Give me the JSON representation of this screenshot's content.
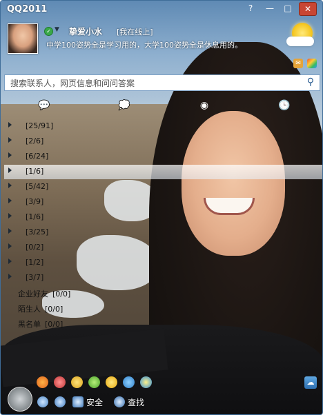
{
  "window": {
    "title": "QQ2011",
    "buttons": {
      "help": "?",
      "minimize": "—",
      "maximize": "□",
      "close": "✕"
    }
  },
  "profile": {
    "nickname": "挚爱小水",
    "status": "[我在线上]",
    "signature": "中学100姿势全是学习用的，大学100姿势全是休息用的。"
  },
  "search": {
    "placeholder": "搜索联系人，网页信息和问问答案",
    "icon": "⚲"
  },
  "tabs": [
    {
      "name": "contacts",
      "glyph": "💬"
    },
    {
      "name": "groups",
      "glyph": "💭"
    },
    {
      "name": "qzone",
      "glyph": "◉"
    },
    {
      "name": "recent",
      "glyph": "🕒"
    }
  ],
  "groups": [
    {
      "label": "",
      "count": "[25/91]"
    },
    {
      "label": "",
      "count": "[2/6]"
    },
    {
      "label": "",
      "count": "[6/24]"
    },
    {
      "label": "",
      "count": "[1/6]"
    },
    {
      "label": "",
      "count": "[5/42]"
    },
    {
      "label": "",
      "count": "[3/9]"
    },
    {
      "label": "",
      "count": "[1/6]"
    },
    {
      "label": "",
      "count": "[3/25]"
    },
    {
      "label": "",
      "count": "[0/2]"
    },
    {
      "label": "",
      "count": "[1/2]"
    },
    {
      "label": "",
      "count": "[3/7]"
    }
  ],
  "special_groups": [
    {
      "label": "企业好友",
      "count": "[0/0]"
    },
    {
      "label": "陌生人",
      "count": "[0/0]"
    },
    {
      "label": "黑名单",
      "count": "[0/0]"
    }
  ],
  "bottom": {
    "security_label": "安全",
    "find_label": "查找"
  },
  "colors": {
    "titlebar_text": "#ffffff",
    "close_button": "#c84633",
    "highlight_row": "#e8f0f8",
    "border": "#3f6d99"
  }
}
